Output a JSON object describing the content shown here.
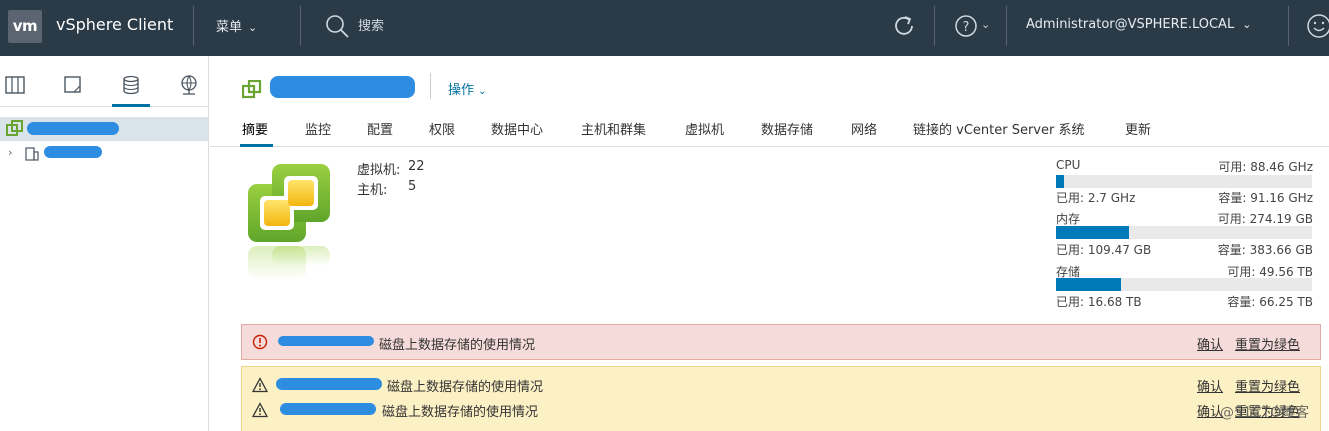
{
  "header": {
    "logo_text": "vm",
    "app_title": "vSphere Client",
    "menu_label": "菜单",
    "search_placeholder": "搜索",
    "user": "Administrator@VSPHERE.LOCAL"
  },
  "main": {
    "actions_label": "操作",
    "tabs": [
      {
        "label": "摘要"
      },
      {
        "label": "监控"
      },
      {
        "label": "配置"
      },
      {
        "label": "权限"
      },
      {
        "label": "数据中心"
      },
      {
        "label": "主机和群集"
      },
      {
        "label": "虚拟机"
      },
      {
        "label": "数据存储"
      },
      {
        "label": "网络"
      },
      {
        "label": "链接的 vCenter Server 系统"
      },
      {
        "label": "更新"
      }
    ],
    "summary": {
      "vm_label": "虚拟机:",
      "vm_count": "22",
      "host_label": "主机:",
      "host_count": "5"
    },
    "resources": [
      {
        "name": "CPU",
        "free": "可用: 88.46 GHz",
        "used": "已用: 2.7 GHz",
        "capacity": "容量: 91.16 GHz",
        "fraction": 0.03
      },
      {
        "name": "内存",
        "free": "可用: 274.19 GB",
        "used": "已用: 109.47 GB",
        "capacity": "容量: 383.66 GB",
        "fraction": 0.285
      },
      {
        "name": "存储",
        "free": "可用: 49.56 TB",
        "used": "已用: 16.68 TB",
        "capacity": "容量: 66.25 TB",
        "fraction": 0.252
      }
    ],
    "alerts": {
      "error": {
        "text": "磁盘上数据存储的使用情况",
        "ack": "确认",
        "reset": "重置为绿色"
      },
      "warnings": [
        {
          "text": "磁盘上数据存储的使用情况",
          "ack": "确认",
          "reset": "重置为绿色"
        },
        {
          "text": "磁盘上数据存储的使用情况",
          "ack": "确认",
          "reset": "重置为绿色"
        }
      ]
    }
  },
  "watermark": "@51CTO博客",
  "colors": {
    "header_bg": "#2b3a47",
    "accent": "#0072a3",
    "bar_fill": "#0079b8",
    "error_bg": "#f5dbd9",
    "warning_bg": "#fcf1c5"
  }
}
